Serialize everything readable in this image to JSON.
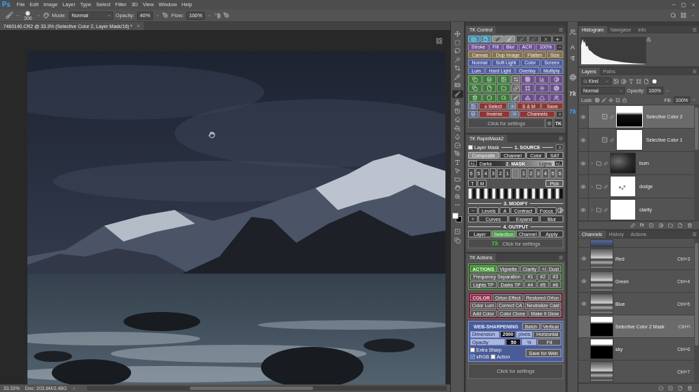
{
  "app_logo": "Ps",
  "menu_bar": {
    "items": [
      "File",
      "Edit",
      "Image",
      "Layer",
      "Type",
      "Select",
      "Filter",
      "3D",
      "View",
      "Window",
      "Help"
    ]
  },
  "options_bar": {
    "brush_size": "300",
    "mode_label": "Mode:",
    "mode": "Normal",
    "opacity_label": "Opacity:",
    "opacity": "40%",
    "flow_label": "Flow:",
    "flow": "100%"
  },
  "document_tab": {
    "title": "7460140.CR2 @ 33.3% (Selective Color 2, Layer Mask/16) *"
  },
  "tools": [
    {
      "kind": "move",
      "selected": false
    },
    {
      "kind": "marquee",
      "selected": false
    },
    {
      "kind": "lasso",
      "selected": false
    },
    {
      "kind": "wand",
      "selected": false
    },
    {
      "kind": "crop",
      "selected": false
    },
    {
      "kind": "eyedropper",
      "selected": false
    },
    {
      "kind": "healing",
      "selected": false
    },
    {
      "kind": "brush",
      "selected": true
    },
    {
      "kind": "stamp",
      "selected": false
    },
    {
      "kind": "history",
      "selected": false
    },
    {
      "kind": "eraser",
      "selected": false
    },
    {
      "kind": "bucket",
      "selected": false
    },
    {
      "kind": "blur",
      "selected": false
    },
    {
      "kind": "dodge",
      "selected": false
    },
    {
      "kind": "pen",
      "selected": false
    },
    {
      "kind": "type",
      "selected": false
    },
    {
      "kind": "pointer",
      "selected": false
    },
    {
      "kind": "rectangle",
      "selected": false
    },
    {
      "kind": "hand",
      "selected": false
    },
    {
      "kind": "zoom",
      "selected": false
    },
    {
      "kind": "more",
      "selected": false
    }
  ],
  "status_bar": {
    "zoom": "33.33%",
    "doc_size": "Doc: 203.6M/2.48G"
  },
  "tk_control": {
    "title": "TK Control",
    "rows": [
      {
        "color": "#6c4f93",
        "buttons": [
          "Stroke",
          "Fill",
          "Blur",
          "ACR",
          "100%"
        ]
      },
      {
        "color": "#84704a",
        "buttons": [
          "Canvas",
          "Dup Image",
          "Flatten",
          "Size"
        ]
      },
      {
        "color": "#4d5ba3",
        "buttons": [
          "Normal",
          "Soft Light",
          "Color",
          "Screen"
        ]
      },
      {
        "color": "#4d5ba3",
        "buttons": [
          "Lum",
          "Hard Light",
          "Overlay",
          "Multiply"
        ]
      }
    ],
    "select_rows": [
      {
        "color": "#8c3636",
        "buttons": [
          "± Select",
          "S & M",
          "Save"
        ]
      },
      {
        "color": "#8c3636",
        "buttons": [
          "Inverse",
          "Channels"
        ]
      }
    ],
    "settings": "Click for settings",
    "badge": "TK"
  },
  "rapid_mask": {
    "title": "TK RapidMask2",
    "layer_mask": {
      "label": "Layer Mask",
      "checked": false
    },
    "source_label": "1. SOURCE",
    "sources": [
      {
        "label": "Composite",
        "selected": true
      },
      {
        "label": "Channel",
        "selected": false
      },
      {
        "label": "Color",
        "selected": false
      },
      {
        "label": "SAT",
        "selected": false
      }
    ],
    "toggle": "+/-",
    "dark_label": "Darks",
    "mask_label": "2. MASK",
    "light_label": "Lights",
    "dark_zones": [
      "6",
      "5",
      "4",
      "3",
      "2",
      "1"
    ],
    "light_zones": [
      "1",
      "2",
      "3",
      "4",
      "5",
      "6"
    ],
    "small_buttons": [
      "T",
      "M"
    ],
    "pick": "Pick",
    "modify_label": "3. MODIFY",
    "modify_rows": [
      {
        "buttons": [
          "Levels",
          "A",
          "Contract",
          "Focus"
        ]
      },
      {
        "buttons": [
          "Curves",
          "Expand",
          "Blur"
        ]
      }
    ],
    "output_label": "4. OUTPUT",
    "outputs": [
      {
        "label": "Layer",
        "selected": false
      },
      {
        "label": "Selection",
        "selected": true
      },
      {
        "label": "Channel",
        "selected": false
      }
    ],
    "apply": "Apply",
    "logo": "Tk",
    "settings": "Click for settings"
  },
  "tk_actions": {
    "title": "TK Actions",
    "sections": [
      {
        "kind": "actions",
        "heading": "ACTIONS",
        "color": "#3b5a35",
        "rows": [
          {
            "buttons": [
              "Vignette",
              "Clarity",
              "+/- Dust"
            ]
          },
          {
            "buttons": [
              "Frequency Separation",
              "#1",
              "#2",
              "#3"
            ]
          },
          {
            "buttons": [
              "Lights TP",
              "Darks TP",
              "#4",
              "#5",
              "#6"
            ]
          }
        ]
      },
      {
        "kind": "color",
        "heading": "COLOR",
        "color": "#5c2a37",
        "rows": [
          {
            "buttons": [
              "Orton Effect",
              "Restored Orton"
            ]
          },
          {
            "buttons": [
              "Color Lum",
              "Correct CA",
              "Neutralize Cast"
            ]
          },
          {
            "buttons": [
              "Add Color",
              "Color Clone",
              "Make it Glow"
            ]
          }
        ]
      }
    ],
    "web": {
      "color": "#4a5c98",
      "heading": "WEB-SHARPENING",
      "batch": "Batch",
      "vertical": "Vertical",
      "dimension_label": "Dimension",
      "dimension": "2000",
      "pixels": "pixels",
      "horizontal": "Horizontal",
      "opacity_label": "Opacity",
      "opacity": "50",
      "percent": "%",
      "fit": "Fit",
      "extra_sharp": {
        "label": "Extra Sharp",
        "checked": false
      },
      "srgb": {
        "label": "sRGB",
        "checked": true
      },
      "action": {
        "label": "Action",
        "checked": false
      },
      "save": "Save for Web"
    },
    "settings": "Click for settings"
  },
  "dock": [
    {
      "kind": "people"
    },
    {
      "kind": "letter",
      "label": "A"
    },
    {
      "kind": "paragraph"
    },
    {
      "kind": "swirl"
    },
    {
      "kind": "logo",
      "label": "Tk",
      "color": "#cfcfcf"
    },
    {
      "kind": "logo",
      "label": "Tk",
      "color": "#4a9be0"
    }
  ],
  "histogram": {
    "tabs": [
      {
        "label": "Histogram",
        "selected": true
      },
      {
        "label": "Navigator",
        "selected": false
      },
      {
        "label": "Info",
        "selected": false
      }
    ]
  },
  "layers": {
    "tabs": [
      {
        "label": "Layers",
        "selected": true
      },
      {
        "label": "Paths",
        "selected": false
      }
    ],
    "filter": "Kind",
    "blend_mode": "Normal",
    "opacity_label": "Opacity:",
    "opacity": "100%",
    "lock_label": "Lock:",
    "fill_label": "Fill:",
    "fill": "100%",
    "items": [
      {
        "name": "Selective Color 2",
        "kind": "adjustment",
        "mask": {
          "kind": "horizon"
        },
        "visible": true,
        "selected": true
      },
      {
        "name": "Selective Color 1",
        "kind": "adjustment",
        "mask": {
          "kind": "white"
        },
        "visible": true,
        "selected": false
      },
      {
        "name": "burn",
        "kind": "group",
        "mask": {
          "kind": "clouds"
        },
        "visible": true,
        "selected": false,
        "expanded": false
      },
      {
        "name": "dodge",
        "kind": "group",
        "mask": {
          "kind": "specks"
        },
        "visible": true,
        "selected": false,
        "expanded": false
      },
      {
        "name": "clarity",
        "kind": "group",
        "mask": {
          "kind": "white"
        },
        "visible": true,
        "selected": false,
        "expanded": false
      }
    ],
    "footer_fx": "fx"
  },
  "channels": {
    "tabs": [
      {
        "label": "Channels",
        "selected": true
      },
      {
        "label": "History",
        "selected": false
      },
      {
        "label": "Actions",
        "selected": false
      }
    ],
    "items": [
      {
        "name": "Red",
        "shortcut": "Ctrl+3",
        "thumbnail": {
          "kind": "landscape"
        },
        "visible": true,
        "selected": false
      },
      {
        "name": "Green",
        "shortcut": "Ctrl+4",
        "thumbnail": {
          "kind": "landscape"
        },
        "visible": true,
        "selected": false
      },
      {
        "name": "Blue",
        "shortcut": "Ctrl+5",
        "thumbnail": {
          "kind": "landscape"
        },
        "visible": true,
        "selected": false
      },
      {
        "name": "Selective Color 2 Mask",
        "shortcut": "Ctrl+\\",
        "thumbnail": {
          "kind": "horizon"
        },
        "visible": false,
        "selected": true
      },
      {
        "name": "sky",
        "shortcut": "Ctrl+6",
        "thumbnail": {
          "kind": "horizon"
        },
        "visible": false,
        "selected": false
      },
      {
        "shortcut": "Ctrl+7",
        "thumbnail": {
          "kind": "landscape"
        },
        "visible": false,
        "selected": false
      }
    ]
  }
}
